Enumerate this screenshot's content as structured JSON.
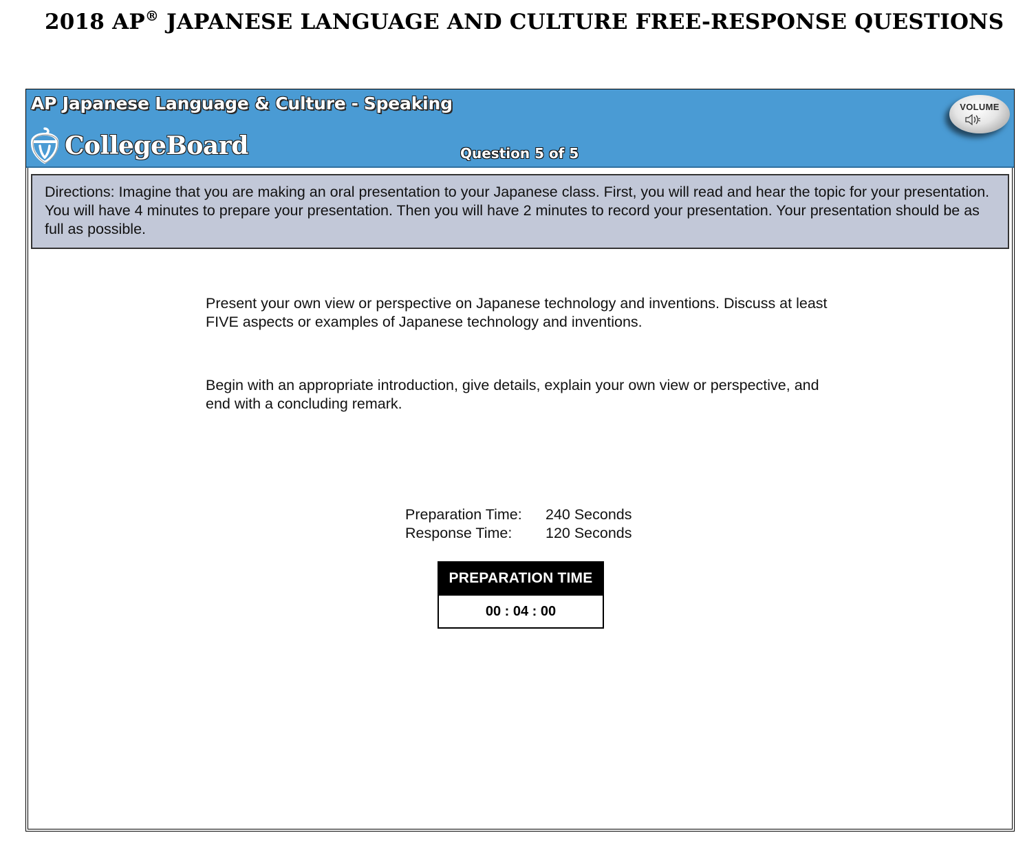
{
  "document": {
    "title_prefix": "2018 AP",
    "title_mark": "®",
    "title_suffix": " JAPANESE LANGUAGE AND CULTURE FREE-RESPONSE QUESTIONS"
  },
  "header": {
    "course": "AP Japanese Language & Culture",
    "separator": "-",
    "section": "Speaking",
    "logo_text": "CollegeBoard",
    "logo_icon": "acorn-icon",
    "question_counter": "Question 5 of 5",
    "volume_label": "VOLUME",
    "volume_icon": "speaker-icon",
    "banner_color": "#4a9bd4"
  },
  "directions": {
    "text": "Directions: Imagine that you are making an oral presentation to your Japanese class. First, you will read and hear the topic for your presentation. You will have 4 minutes to prepare your presentation. Then you will have 2 minutes to record your presentation. Your presentation should be as full as possible.",
    "background_color": "#c2c8d8"
  },
  "prompt": {
    "paragraph_1": "Present your own view or perspective on Japanese technology and inventions. Discuss at least FIVE aspects or examples of Japanese technology and inventions.",
    "paragraph_2": "Begin with an appropriate introduction, give details, explain your own view or perspective, and end with a concluding remark."
  },
  "timing": {
    "preparation_label": "Preparation Time:",
    "preparation_value": "240 Seconds",
    "response_label": "Response Time:",
    "response_value": "120 Seconds"
  },
  "timer": {
    "header": "PREPARATION TIME",
    "clock": "00 : 04 : 00"
  }
}
